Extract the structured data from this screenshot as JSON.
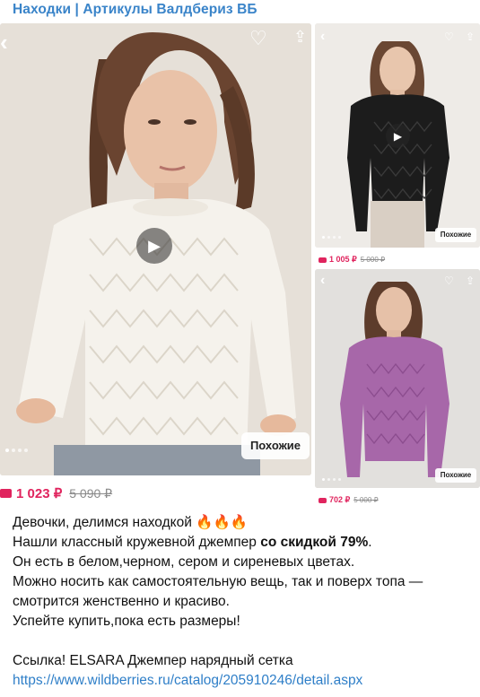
{
  "channel": {
    "title": "Находки | Артикулы Валдбериз ВБ"
  },
  "main_card": {
    "similar_label": "Похожие",
    "price": "1 023 ₽",
    "old_price": "5 090 ₽"
  },
  "card_top": {
    "similar_label": "Похожие",
    "price": "1 005 ₽",
    "old_price": "5 000 ₽"
  },
  "card_bottom": {
    "similar_label": "Похожие",
    "price": "702 ₽",
    "old_price": "5 000 ₽"
  },
  "message": {
    "line1": "Девочки, делимся находкой",
    "line1_emoji": "🔥🔥🔥",
    "line2_start": "Нашли классный кружевной джемпер ",
    "line2_bold": "со скидкой 79%",
    "line2_end": ".",
    "line3": "Он есть в белом,черном, сером и сиреневых цветах.",
    "line4": "Можно носить как самостоятельную вещь, так и поверх топа —",
    "line5": "смотрится женственно и красиво.",
    "line6": "Успейте купить,пока есть размеры!",
    "line7": "Ссылка! ELSARA Джемпер нарядный сетка",
    "link": "https://www.wildberries.ru/catalog/205910246/detail.aspx"
  },
  "colors": {
    "channel_title": "#3a84c9",
    "price_accent": "#e0245e",
    "link": "#2f7fc8"
  },
  "icons": [
    "back-arrow-icon",
    "heart-icon",
    "share-icon",
    "play-icon",
    "price-tag-icon",
    "fire-emoji"
  ]
}
